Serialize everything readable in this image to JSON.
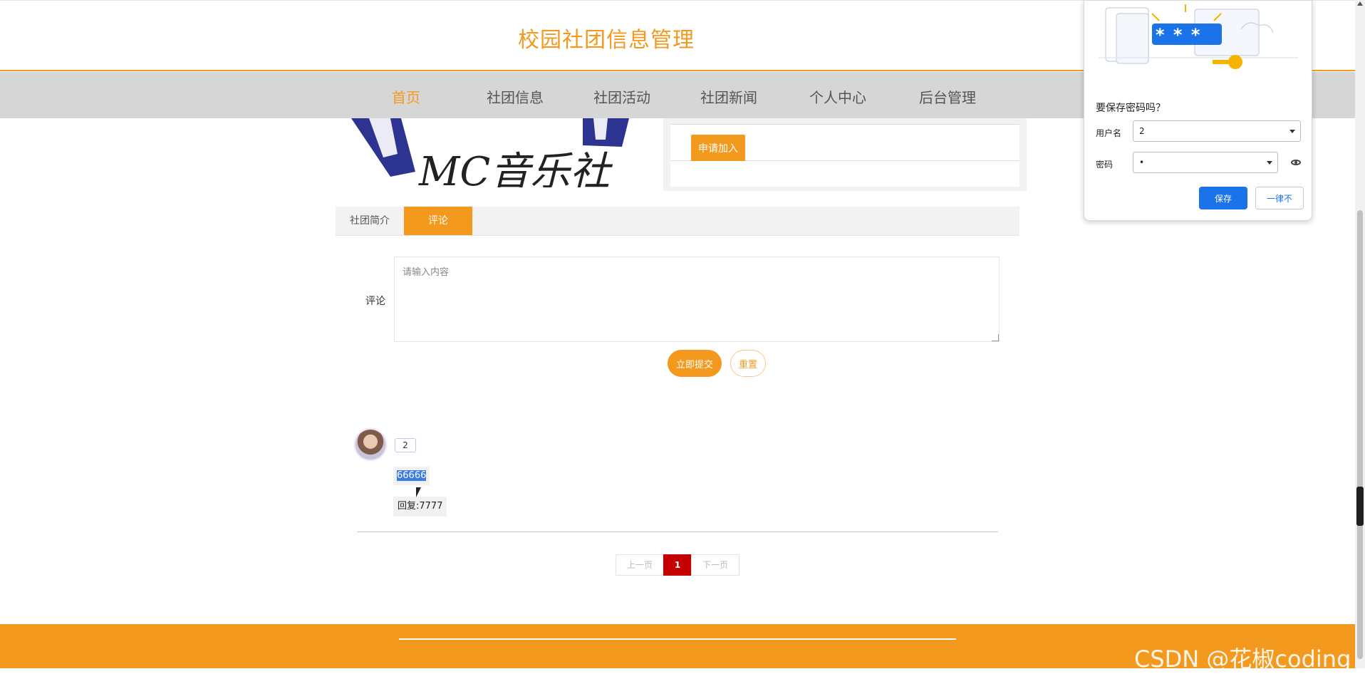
{
  "header": {
    "title": "校园社团信息管理"
  },
  "nav": {
    "items": [
      {
        "label": "首页",
        "active": true
      },
      {
        "label": "社团信息"
      },
      {
        "label": "社团活动"
      },
      {
        "label": "社团新闻"
      },
      {
        "label": "个人中心"
      },
      {
        "label": "后台管理"
      }
    ]
  },
  "club": {
    "banner_text": "MC音乐社",
    "apply_label": "申请加入"
  },
  "tabs": [
    {
      "label": "社团简介"
    },
    {
      "label": "评论",
      "active": true
    }
  ],
  "comment_form": {
    "label": "评论",
    "placeholder": "请输入内容",
    "submit_label": "立即提交",
    "reset_label": "重置"
  },
  "comments": [
    {
      "username": "2",
      "content": "66666",
      "reply": "回复:7777"
    }
  ],
  "pagination": {
    "prev": "上一页",
    "current": "1",
    "next": "下一页"
  },
  "footer": {
    "watermark": "CSDN @花椒coding"
  },
  "password_popup": {
    "question": "要保存密码吗？",
    "username_label": "用户名",
    "username_value": "2",
    "password_label": "密码",
    "password_value": "•",
    "save_label": "保存",
    "never_label": "一律不",
    "illustration_stars": "* * *"
  },
  "colors": {
    "accent": "#f39a1e",
    "popup_primary": "#1a73e8",
    "page_current": "#c40000",
    "selection": "#3e7ce4"
  }
}
